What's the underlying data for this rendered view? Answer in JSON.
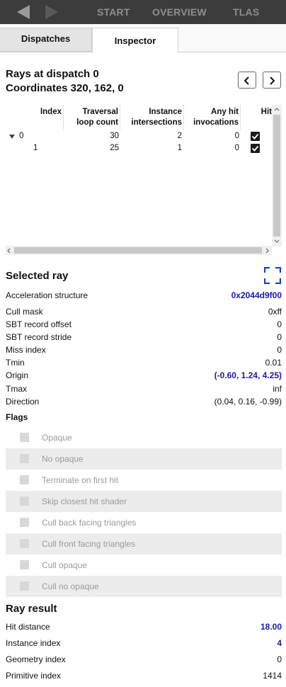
{
  "nav": {
    "back_icon": "back-arrow-icon",
    "forward_icon": "forward-arrow-icon",
    "tabs": [
      "START",
      "OVERVIEW",
      "TLAS"
    ]
  },
  "subtabs": {
    "dispatches": "Dispatches",
    "inspector": "Inspector"
  },
  "rays": {
    "title_line1": "Rays at dispatch 0",
    "title_line2": "Coordinates 320, 162, 0",
    "prev_icon": "chevron-left-icon",
    "next_icon": "chevron-right-icon"
  },
  "table": {
    "headers": {
      "index": "Index",
      "traversal_l1": "Traversal",
      "traversal_l2": "loop count",
      "instance_l1": "Instance",
      "instance_l2": "intersections",
      "anyhit_l1": "Any hit",
      "anyhit_l2": "invocations",
      "hit": "Hit"
    },
    "rows": [
      {
        "index": "0",
        "traversal": "30",
        "instance": "2",
        "anyhit": "0",
        "hit": true
      },
      {
        "index": "1",
        "traversal": "25",
        "instance": "1",
        "anyhit": "0",
        "hit": true
      }
    ]
  },
  "selected_ray": {
    "title": "Selected ray",
    "focus_icon": "focus-frame-icon",
    "props": [
      {
        "label": "Acceleration structure",
        "value": "0x2044d9f00",
        "link": true
      },
      {
        "label": "Cull mask",
        "value": "0xff",
        "link": false
      },
      {
        "label": "SBT record offset",
        "value": "0",
        "link": false
      },
      {
        "label": "SBT record stride",
        "value": "0",
        "link": false
      },
      {
        "label": "Miss index",
        "value": "0",
        "link": false
      },
      {
        "label": "Tmin",
        "value": "0.01",
        "link": false
      },
      {
        "label": "Origin",
        "value": "(-0.60, 1.24, 4.25)",
        "link": true
      },
      {
        "label": "Tmax",
        "value": "inf",
        "link": false
      },
      {
        "label": "Direction",
        "value": "(0.04, 0.16, -0.99)",
        "link": false
      }
    ],
    "flags_title": "Flags",
    "flags": [
      "Opaque",
      "No opaque",
      "Terminate on first hit",
      "Skip closest hit shader",
      "Cull back facing triangles",
      "Cull front facing triangles",
      "Cull opaque",
      "Cull no opaque"
    ]
  },
  "ray_result": {
    "title": "Ray result",
    "props": [
      {
        "label": "Hit distance",
        "value": "18.00",
        "link": true
      },
      {
        "label": "Instance index",
        "value": "4",
        "link": true
      },
      {
        "label": "Geometry index",
        "value": "0",
        "link": false
      },
      {
        "label": "Primitive index",
        "value": "1414",
        "link": false
      }
    ]
  }
}
